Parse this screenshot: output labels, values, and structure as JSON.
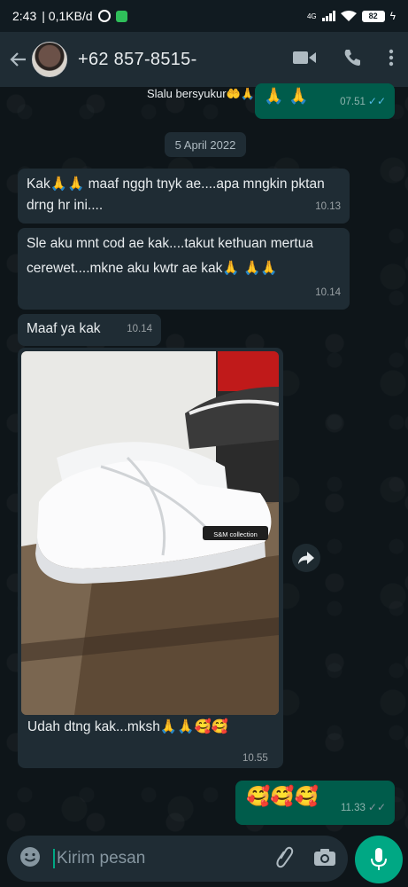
{
  "status_bar": {
    "time": "2:43",
    "net_speed": "0,1KB/d",
    "network_type": "4G",
    "battery_level": "82"
  },
  "header": {
    "contact_name": "+62 857-8515-"
  },
  "messages": {
    "prev_outgoing_text": "Slalu bersyukur🤲🙏",
    "prev_outgoing_emoji": "🙏 🙏",
    "prev_outgoing_time": "07.51",
    "date_divider": "5 April 2022",
    "m1_text": "Kak🙏🙏 maaf nggh tnyk ae....apa mngkin pktan drng hr ini....",
    "m1_time": "10.13",
    "m2_text": "Sle aku mnt cod ae kak....takut kethuan mertua cerewet....mkne aku kwtr ae kak🙏 🙏🙏",
    "m2_time": "10.14",
    "m3_text": "Maaf ya kak",
    "m3_time": "10.14",
    "m4_image_label": "S&M collection",
    "m4_caption": "Udah dtng kak...mksh🙏🙏🥰🥰",
    "m4_time": "10.55",
    "m5_text": "🥰🥰🥰",
    "m5_time": "11.33"
  },
  "input": {
    "placeholder": "Kirim pesan"
  },
  "colors": {
    "header_bg": "#1f2c34",
    "incoming_bubble": "#1f2c34",
    "outgoing_bubble": "#005c4b",
    "accent": "#00a884",
    "read_ticks": "#53bdeb"
  }
}
